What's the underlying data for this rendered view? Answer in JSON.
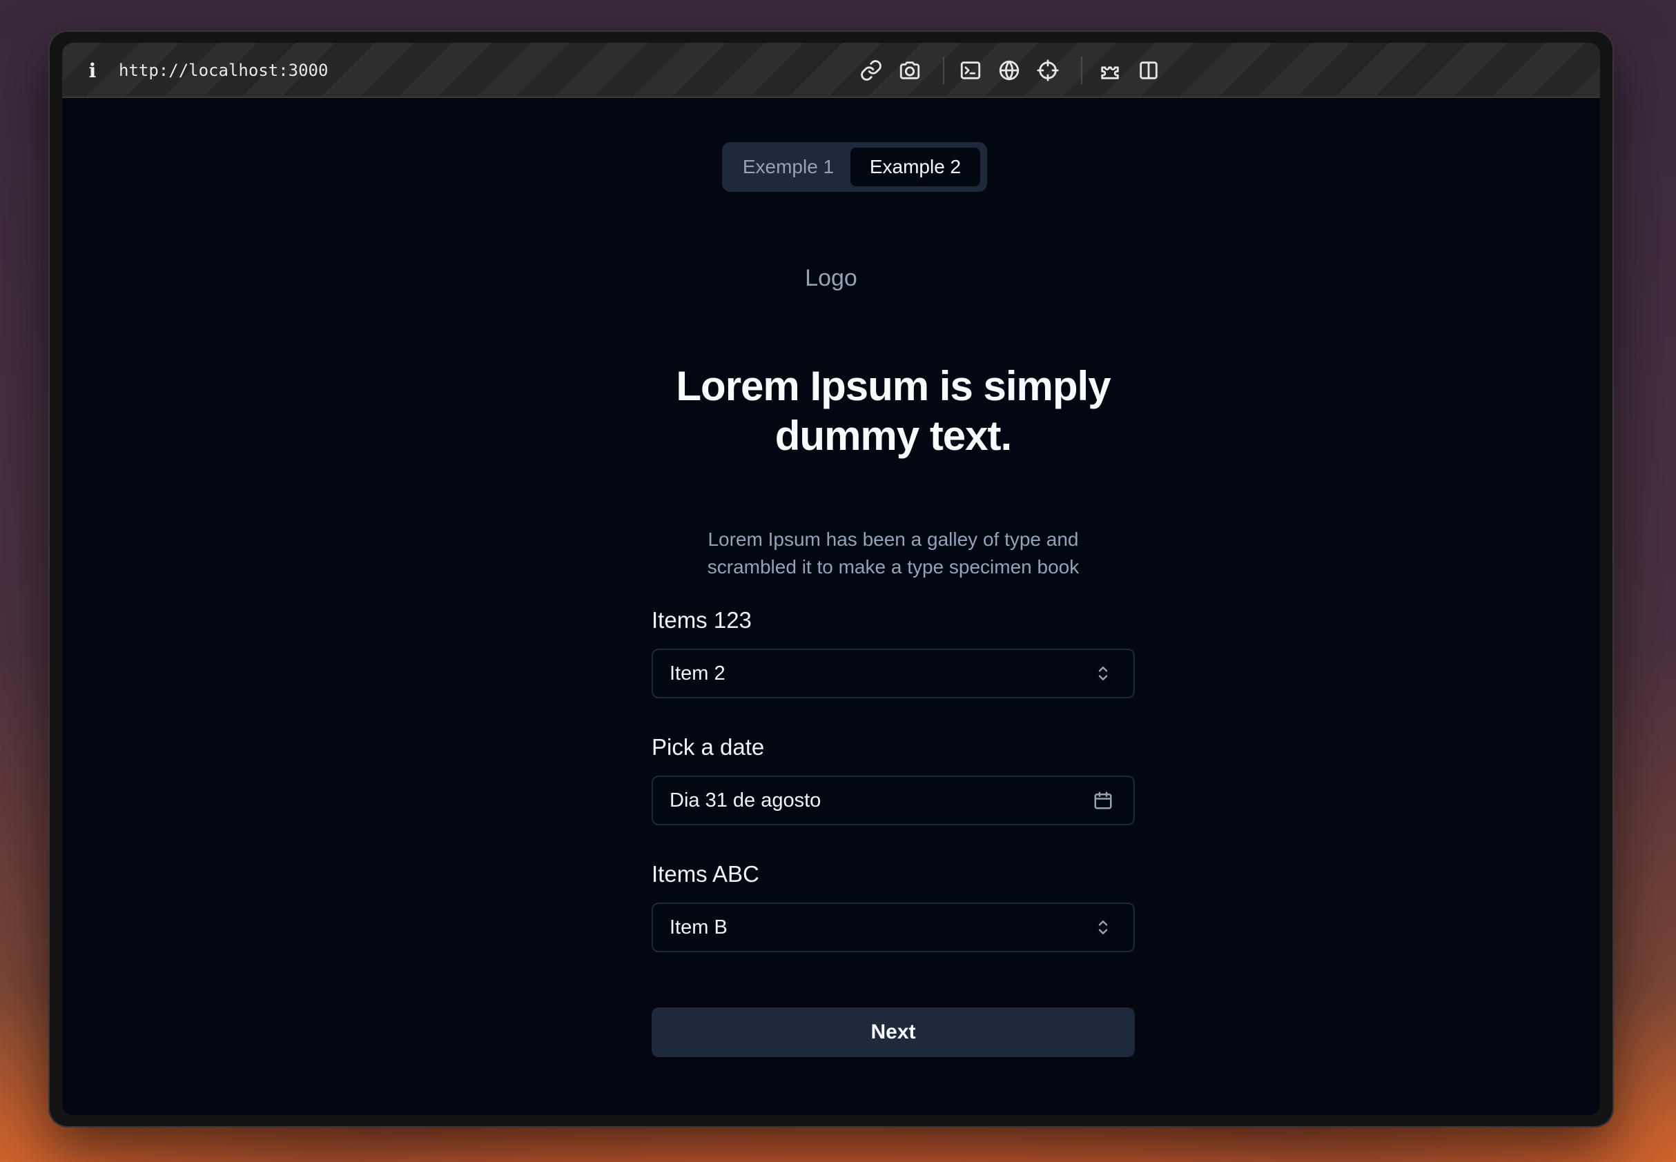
{
  "browser": {
    "url": "http://localhost:3000",
    "icons": [
      "info-icon",
      "link-icon",
      "camera-icon",
      "terminal-icon",
      "globe-icon",
      "crosshair-icon",
      "puzzle-icon",
      "split-view-icon"
    ]
  },
  "tabs": [
    {
      "label": "Exemple 1",
      "active": false
    },
    {
      "label": "Example 2",
      "active": true
    }
  ],
  "logo": "Logo",
  "heading": {
    "line1": "Lorem Ipsum is simply",
    "line2": "dummy text."
  },
  "subtext": {
    "line1": "Lorem Ipsum has been a galley of type and",
    "line2": "scrambled it to make a type specimen book"
  },
  "form": {
    "items123": {
      "label": "Items 123",
      "value": "Item 2"
    },
    "date": {
      "label": "Pick a date",
      "value": "Dia 31 de agosto"
    },
    "itemsABC": {
      "label": "Items ABC",
      "value": "Item B"
    }
  },
  "next_label": "Next",
  "colors": {
    "page_bg": "#020711",
    "muted": "#94a3b8",
    "surface": "#1e293b",
    "foreground": "#f8fafc"
  }
}
